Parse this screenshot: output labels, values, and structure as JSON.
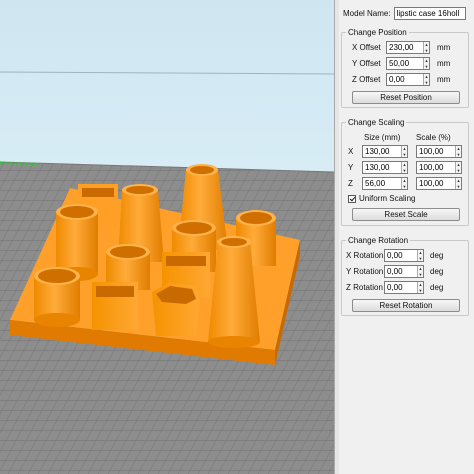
{
  "model": {
    "name_label": "Model Name:",
    "name_value": "lipstic case 16holl"
  },
  "position": {
    "title": "Change Position",
    "x_label": "X Offset",
    "x_value": "230,00",
    "x_unit": "mm",
    "y_label": "Y Offset",
    "y_value": "50,00",
    "y_unit": "mm",
    "z_label": "Z Offset",
    "z_value": "0,00",
    "z_unit": "mm",
    "reset_label": "Reset Position"
  },
  "scaling": {
    "title": "Change Scaling",
    "size_header": "Size (mm)",
    "scale_header": "Scale (%)",
    "x_label": "X",
    "x_size": "130,00",
    "x_scale": "100,00",
    "y_label": "Y",
    "y_size": "130,00",
    "y_scale": "100,00",
    "z_label": "Z",
    "z_size": "56,00",
    "z_scale": "100,00",
    "uniform_label": "Uniform Scaling",
    "uniform_checked": true,
    "reset_label": "Reset Scale"
  },
  "rotation": {
    "title": "Change Rotation",
    "x_label": "X Rotation",
    "x_value": "0,00",
    "x_unit": "deg",
    "y_label": "Y Rotation",
    "y_value": "0,00",
    "y_unit": "deg",
    "z_label": "Z Rotation",
    "z_value": "0,00",
    "z_unit": "deg",
    "reset_label": "Reset Rotation"
  },
  "colors": {
    "model": "#ff9a1a",
    "model_dark": "#e67e00",
    "model_shadow": "#c86a00",
    "bed": "#8a8a8a",
    "sky": "#d6ecf5",
    "axis_green": "#22cc33"
  }
}
